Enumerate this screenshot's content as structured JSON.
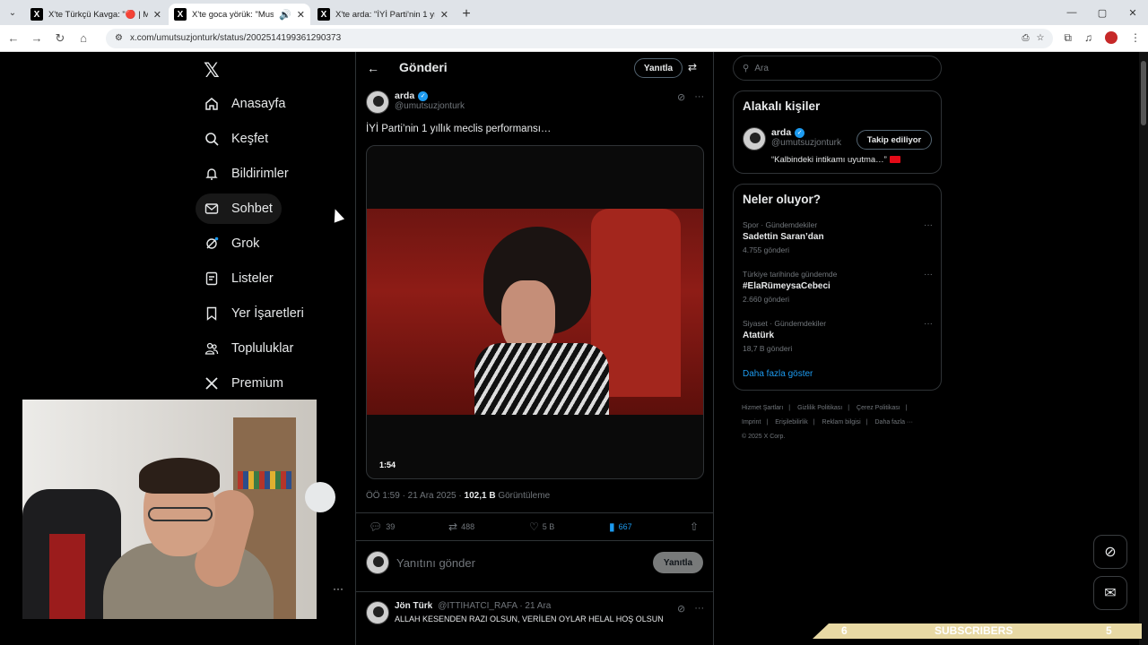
{
  "browser": {
    "tabs": [
      {
        "title": "X'te Türkçü Kavga: \"🔴 | Müsta...",
        "active": false
      },
      {
        "title": "X'te goca yörük: \"Mustafa K...",
        "active": true
      },
      {
        "title": "X'te arda: \"İYİ Parti'nin 1 yıllık m...",
        "active": false
      }
    ],
    "url": "x.com/umutsuzjonturk/status/2002514199361290373",
    "win_min": "—",
    "win_max": "▢",
    "win_close": "✕"
  },
  "nav": {
    "items": [
      {
        "label": "Anasayfa",
        "icon": "home-icon"
      },
      {
        "label": "Keşfet",
        "icon": "search-icon"
      },
      {
        "label": "Bildirimler",
        "icon": "bell-icon"
      },
      {
        "label": "Sohbet",
        "icon": "mail-icon"
      },
      {
        "label": "Grok",
        "icon": "grok-icon"
      },
      {
        "label": "Listeler",
        "icon": "list-icon"
      },
      {
        "label": "Yer İşaretleri",
        "icon": "bookmark-icon"
      },
      {
        "label": "Topluluklar",
        "icon": "people-icon"
      },
      {
        "label": "Premium",
        "icon": "x-icon"
      }
    ]
  },
  "main": {
    "title": "Gönderi",
    "reply_pill": "Yanıtla",
    "post": {
      "name": "arda",
      "handle": "@umutsuzjonturk",
      "text": "İYİ Parti’nin 1 yıllık meclis performansı…",
      "video_duration": "1:54",
      "meta_time": "ÖÖ 1:59 · 21 Ara 2025 · ",
      "views": "102,1 B",
      "views_label": " Görüntüleme",
      "stats": {
        "replies": "39",
        "reposts": "488",
        "likes": "5 B",
        "bookmarks": "667"
      }
    },
    "reply_box": {
      "placeholder": "Yanıtını gönder",
      "button": "Yanıtla"
    },
    "next_reply": {
      "name": "Jön Türk",
      "handle": "@ITTIHATCI_RAFA · 21 Ara",
      "text": "ALLAH KESENDEN RAZI OLSUN, VERİLEN OYLAR HELAL HOŞ OLSUN"
    }
  },
  "right": {
    "search_placeholder": "Ara",
    "related": {
      "title": "Alakalı kişiler",
      "name": "arda",
      "handle": "@umutsuzjonturk",
      "follow": "Takip ediliyor",
      "bio": "“Kalbindeki intikamı uyutma…”"
    },
    "trends": {
      "title": "Neler oluyor?",
      "items": [
        {
          "category": "Spor · Gündemdekiler",
          "title": "Sadettin Saran’dan",
          "count": "4.755 gönderi"
        },
        {
          "category": "Türkiye tarihinde gündemde",
          "title": "#ElaRümeysaCebeci",
          "count": "2.660 gönderi"
        },
        {
          "category": "Siyaset · Gündemdekiler",
          "title": "Atatürk",
          "count": "18,7 B gönderi"
        }
      ],
      "show_more": "Daha fazla göster"
    },
    "footer": [
      "Hizmet Şartları",
      "|",
      "Gizlilik Politikası",
      "|",
      "Çerez Politikası",
      "|",
      "Imprint",
      "|",
      "Erişilebilirlik",
      "|",
      "Reklam bilgisi",
      "|",
      "Daha fazla ···",
      "© 2025 X Corp."
    ]
  },
  "subscriber_banner": {
    "left": "6",
    "label": "SUBSCRIBERS",
    "right": "5"
  }
}
